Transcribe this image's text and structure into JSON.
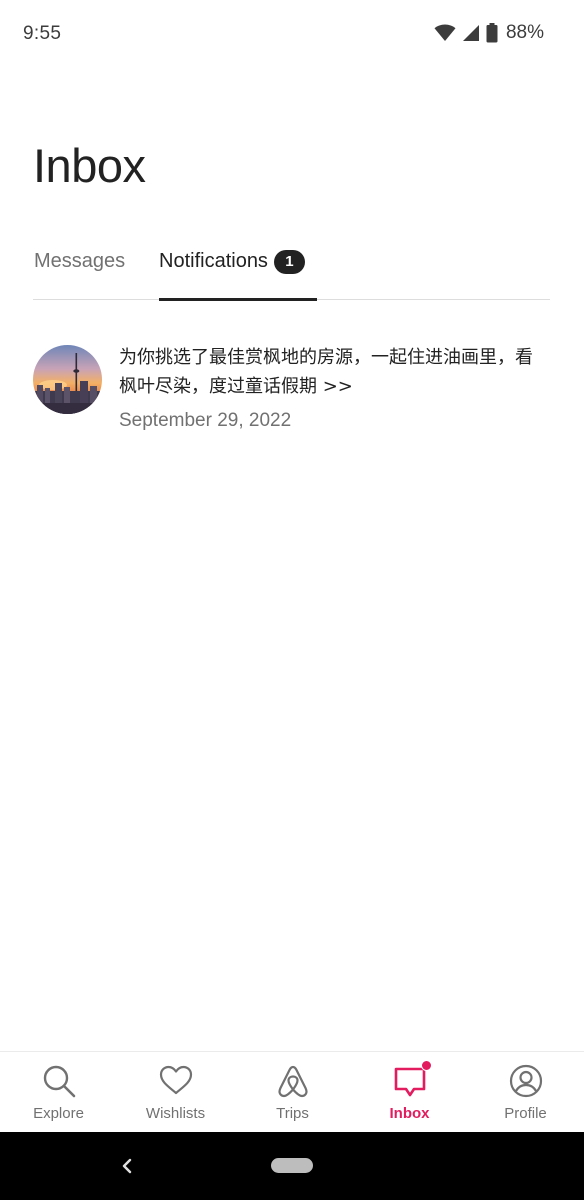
{
  "status_bar": {
    "time": "9:55",
    "battery": "88%",
    "icons": [
      "wifi-icon",
      "signal-icon",
      "battery-icon"
    ]
  },
  "header": {
    "title": "Inbox"
  },
  "tabs": {
    "messages_label": "Messages",
    "notifications_label": "Notifications",
    "notifications_badge": "1",
    "active": "notifications"
  },
  "notifications": [
    {
      "text": "为你挑选了最佳赏枫地的房源，一起住进油画里，看枫叶尽染，度过童话假期 >>",
      "date": "September 29, 2022",
      "avatar": "city-skyline-sunset-image"
    }
  ],
  "bottom_nav": {
    "items": [
      {
        "label": "Explore",
        "icon": "search-icon"
      },
      {
        "label": "Wishlists",
        "icon": "heart-icon"
      },
      {
        "label": "Trips",
        "icon": "airbnb-logo-icon"
      },
      {
        "label": "Inbox",
        "icon": "message-icon"
      },
      {
        "label": "Profile",
        "icon": "profile-icon"
      }
    ],
    "active": "Inbox"
  },
  "colors": {
    "accent": "#e31c5f",
    "text_primary": "#222222",
    "text_secondary": "#717171"
  }
}
